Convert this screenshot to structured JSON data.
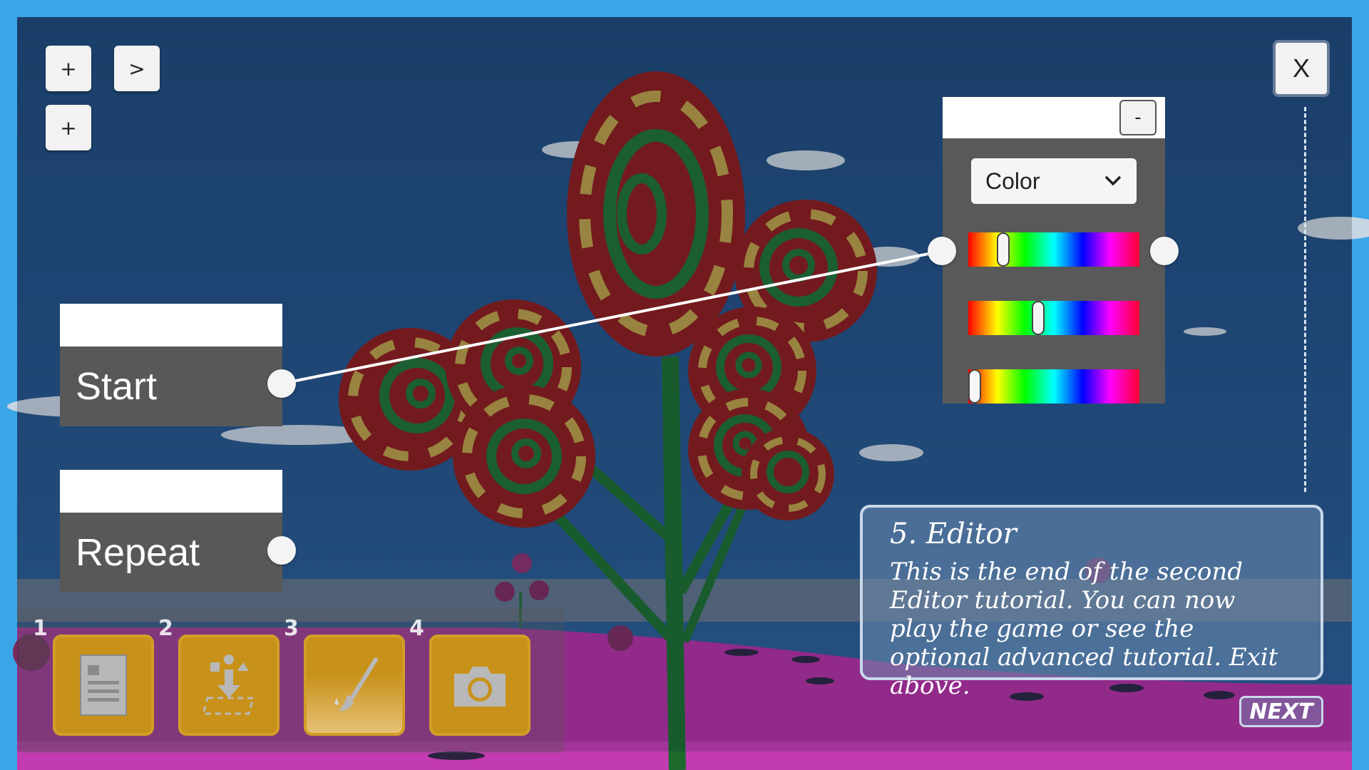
{
  "toolbar_top": {
    "add_button_1": "+",
    "add_button_2": "+",
    "play_button": ">"
  },
  "nodes": {
    "start_label": "Start",
    "repeat_label": "Repeat"
  },
  "color_panel": {
    "collapse_button": "-",
    "mode_select_value": "Color",
    "slider_levels": [
      0.18,
      0.4,
      0.0
    ]
  },
  "exit_button": "X",
  "tutorial": {
    "title": "5. Editor",
    "body": "This is the end of the second Editor tutorial. You can now play the game or see the optional advanced tutorial. Exit above.",
    "next_label": "NEXT"
  },
  "bottom_toolbar": {
    "tools": [
      {
        "number": "1",
        "icon": "document-icon"
      },
      {
        "number": "2",
        "icon": "place-object-icon"
      },
      {
        "number": "3",
        "icon": "paintbrush-icon"
      },
      {
        "number": "4",
        "icon": "camera-icon"
      }
    ]
  },
  "colors": {
    "sky": "#1e4d82",
    "ground": "#b02e9e",
    "panel": "#585858",
    "tool_button": "#c8921a"
  }
}
